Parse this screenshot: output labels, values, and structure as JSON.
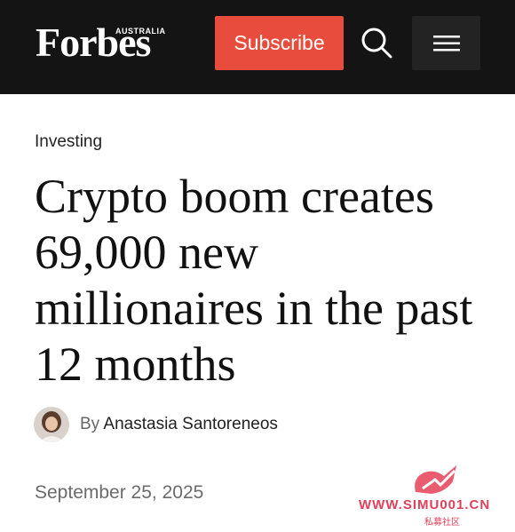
{
  "header": {
    "logo_text": "Forbes",
    "logo_edition": "AUSTRALIA",
    "subscribe_label": "Subscribe",
    "search_icon": "search-icon",
    "menu_icon": "hamburger-menu-icon",
    "background_color": "#141414",
    "accent_color": "#e74c3c"
  },
  "article": {
    "category": "Investing",
    "headline": "Crypto boom creates 69,000 new millionaires in the past 12 months",
    "byline_prefix": "By",
    "author": "Anastasia Santoreneos",
    "date": "September 25, 2025"
  },
  "watermark": {
    "url": "WWW.SIMU001.CN",
    "subtitle": "私募社区"
  }
}
